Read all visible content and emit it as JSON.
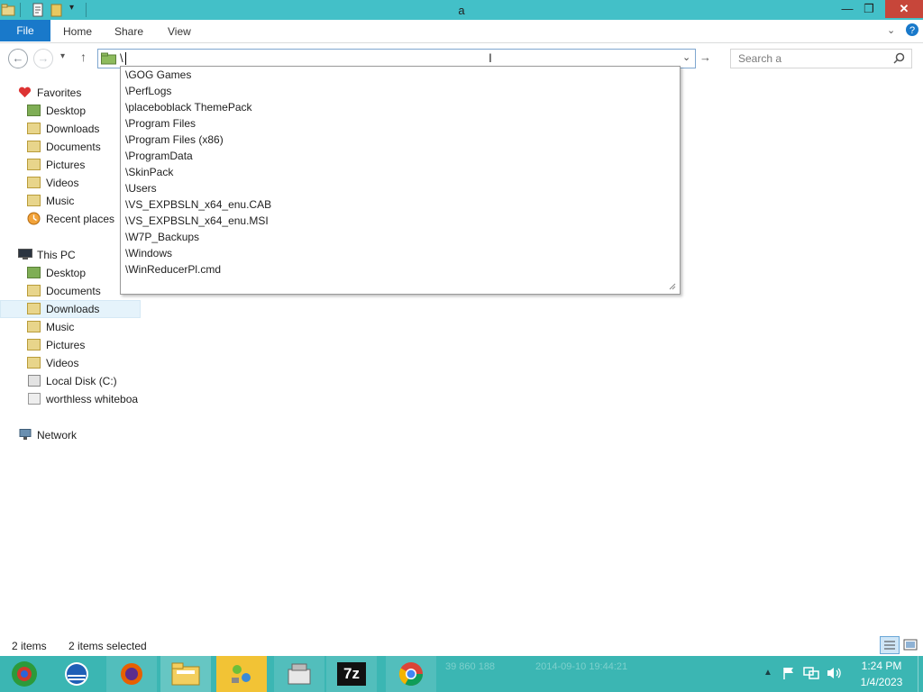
{
  "window": {
    "title": "a"
  },
  "ribbon": {
    "file": "File",
    "tabs": [
      "Home",
      "Share",
      "View"
    ]
  },
  "address": {
    "value": "\\"
  },
  "search": {
    "placeholder": "Search a"
  },
  "sidebar": {
    "favorites": {
      "label": "Favorites",
      "items": [
        "Desktop",
        "Downloads",
        "Documents",
        "Pictures",
        "Videos",
        "Music",
        "Recent places"
      ]
    },
    "this_pc": {
      "label": "This PC",
      "items": [
        "Desktop",
        "Documents",
        "Downloads",
        "Music",
        "Pictures",
        "Videos",
        "Local Disk (C:)",
        "worthless whiteboa"
      ],
      "selected": "Downloads"
    },
    "network": {
      "label": "Network"
    }
  },
  "autocomplete": [
    "\\GOG Games",
    "\\PerfLogs",
    "\\placeboblack ThemePack",
    "\\Program Files",
    "\\Program Files (x86)",
    "\\ProgramData",
    "\\SkinPack",
    "\\Users",
    "\\VS_EXPBSLN_x64_enu.CAB",
    "\\VS_EXPBSLN_x64_enu.MSI",
    "\\W7P_Backups",
    "\\Windows",
    "\\WinReducerPl.cmd"
  ],
  "status": {
    "count": "2 items",
    "selected": "2 items selected"
  },
  "taskbar": {
    "ghost_text": {
      "size": "39 860 188",
      "date": "2014-09-10 19:44:21"
    },
    "clock": {
      "time": "1:24 PM",
      "date": "1/4/2023"
    }
  },
  "colors": {
    "title_bar": "#43c0c8",
    "file_tab": "#1979ca",
    "taskbar": "#3bb6b3",
    "close": "#c7463a"
  }
}
